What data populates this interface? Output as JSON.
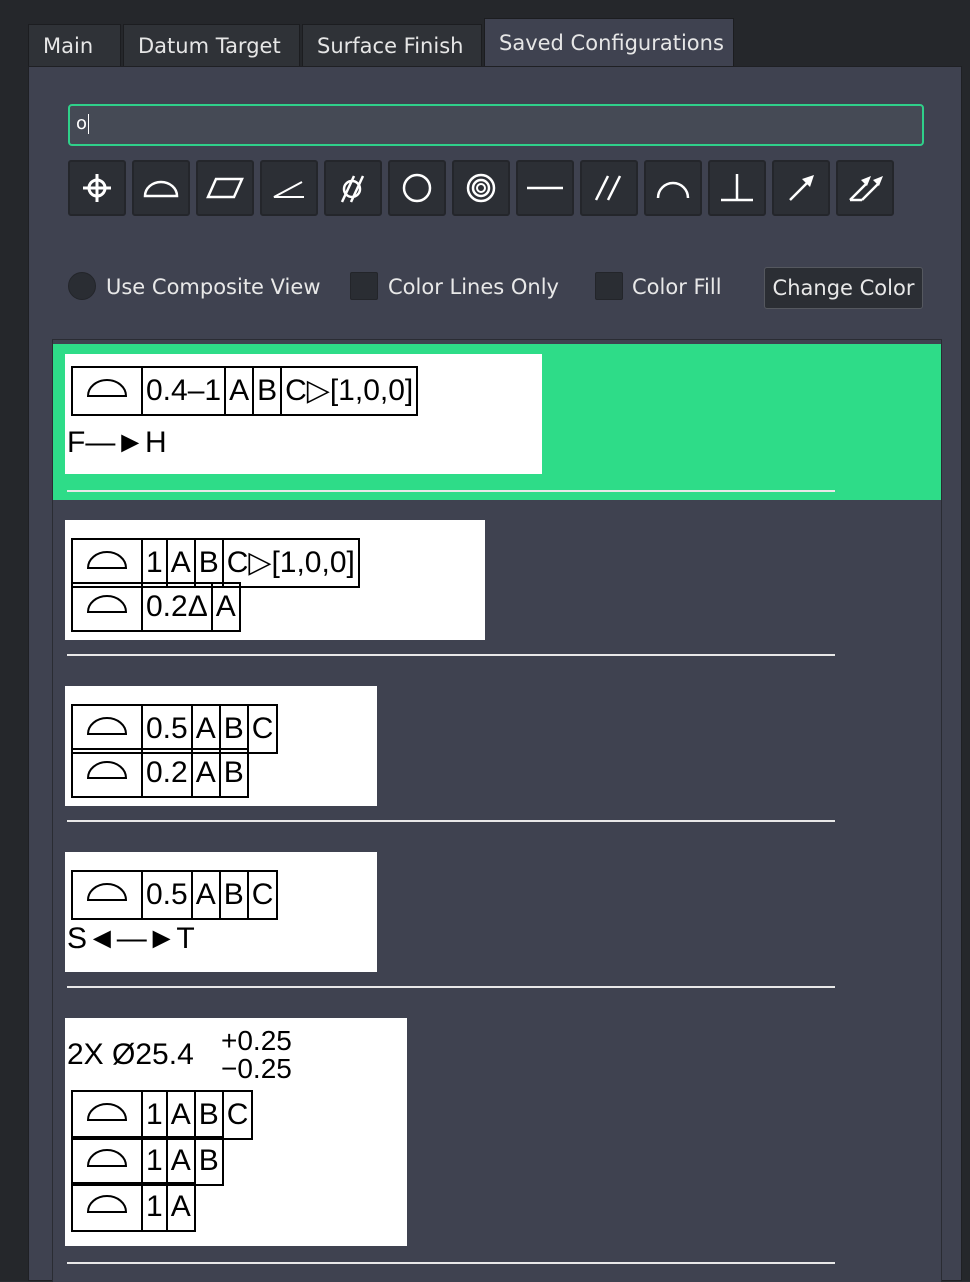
{
  "tabs": [
    {
      "label": "Main",
      "active": false
    },
    {
      "label": "Datum Target",
      "active": false
    },
    {
      "label": "Surface Finish",
      "active": false
    },
    {
      "label": "Saved Configurations",
      "active": true
    }
  ],
  "search": {
    "value": "o"
  },
  "toolbar": {
    "icons": [
      "position-icon",
      "profile-of-surface-icon",
      "flatness-icon",
      "angularity-icon",
      "cylindricity-icon",
      "circularity-icon",
      "concentricity-icon",
      "straightness-icon",
      "parallelism-icon",
      "profile-of-line-icon",
      "perpendicularity-icon",
      "circular-runout-icon",
      "total-runout-icon"
    ]
  },
  "options": {
    "composite_label": "Use Composite View",
    "color_lines_label": "Color Lines Only",
    "color_fill_label": "Color Fill",
    "change_color_label": "Change Color"
  },
  "colors": {
    "accent": "#2edc88",
    "panel": "#3f4250",
    "selected_row": "#2edc88"
  },
  "configs": [
    {
      "selected": true,
      "rows": [
        {
          "symbol": "profile-of-surface",
          "cells": [
            "0.4–1",
            "A",
            "B",
            "C▷[1,0,0]"
          ]
        }
      ],
      "note": "F—►H"
    },
    {
      "selected": false,
      "rows": [
        {
          "symbol": "profile-of-surface",
          "cells": [
            "1",
            "A",
            "B",
            "C▷[1,0,0]"
          ]
        },
        {
          "symbol": "profile-of-surface",
          "cells": [
            "0.2Δ",
            "A"
          ]
        }
      ]
    },
    {
      "selected": false,
      "rows": [
        {
          "symbol": "profile-of-surface",
          "cells": [
            "0.5",
            "A",
            "B",
            "C"
          ]
        },
        {
          "symbol": "profile-of-surface",
          "cells": [
            "0.2",
            "A",
            "B"
          ]
        }
      ]
    },
    {
      "selected": false,
      "rows": [
        {
          "symbol": "profile-of-surface",
          "cells": [
            "0.5",
            "A",
            "B",
            "C"
          ]
        }
      ],
      "note": "S◄—►T"
    },
    {
      "selected": false,
      "tolerance": {
        "prefix": "2X  Ø25.4",
        "upper": "+0.25",
        "lower": "−0.25"
      },
      "rows": [
        {
          "symbol": "profile-of-surface",
          "cells": [
            "1",
            "A",
            "B",
            "C"
          ]
        },
        {
          "symbol": "profile-of-surface",
          "cells": [
            "1",
            "A",
            "B"
          ]
        },
        {
          "symbol": "profile-of-surface",
          "cells": [
            "1",
            "A"
          ]
        }
      ]
    }
  ]
}
